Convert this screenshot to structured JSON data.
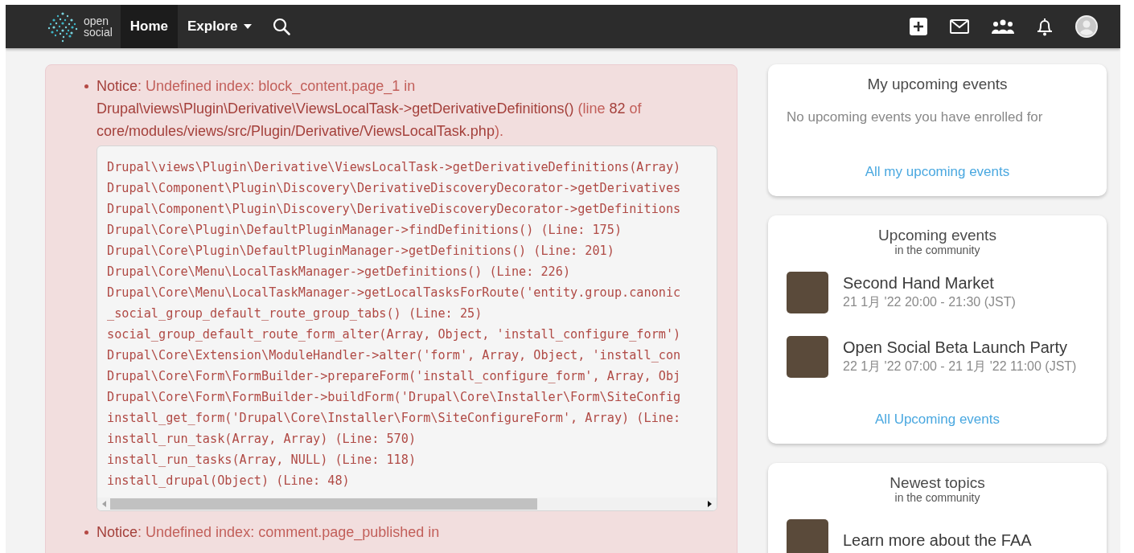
{
  "navbar": {
    "logo": {
      "line_1": "open",
      "line_2": "social"
    },
    "items": [
      {
        "label": "Home",
        "selected": true,
        "kind": "link"
      },
      {
        "label": "Explore",
        "selected": false,
        "kind": "dropdown"
      }
    ],
    "actions": [
      {
        "kind": "create"
      },
      {
        "kind": "messages"
      },
      {
        "kind": "groups"
      },
      {
        "kind": "notifications"
      },
      {
        "kind": "account"
      }
    ]
  },
  "messages": [
    {
      "text": "**Notice**: Undefined index: block_content.page_1 in **Drupal\\views\\Plugin\\Derivative\\ViewsLocalTask->getDerivativeDefinitions()** (line **82** of **core/modules/views/src/Plugin/Derivative/ViewsLocalTask.php**).",
      "trace": [
        "Drupal\\views\\Plugin\\Derivative\\ViewsLocalTask->getDerivativeDefinitions(Array)",
        "Drupal\\Component\\Plugin\\Discovery\\DerivativeDiscoveryDecorator->getDerivatives",
        "Drupal\\Component\\Plugin\\Discovery\\DerivativeDiscoveryDecorator->getDefinitions",
        "Drupal\\Core\\Plugin\\DefaultPluginManager->findDefinitions() (Line: 175)",
        "Drupal\\Core\\Plugin\\DefaultPluginManager->getDefinitions() (Line: 201)",
        "Drupal\\Core\\Menu\\LocalTaskManager->getDefinitions() (Line: 226)",
        "Drupal\\Core\\Menu\\LocalTaskManager->getLocalTasksForRoute('entity.group.canonic",
        "_social_group_default_route_group_tabs() (Line: 25)",
        "social_group_default_route_form_alter(Array, Object, 'install_configure_form')",
        "Drupal\\Core\\Extension\\ModuleHandler->alter('form', Array, Object, 'install_con",
        "Drupal\\Core\\Form\\FormBuilder->prepareForm('install_configure_form', Array, Obj",
        "Drupal\\Core\\Form\\FormBuilder->buildForm('Drupal\\Core\\Installer\\Form\\SiteConfig",
        "install_get_form('Drupal\\Core\\Installer\\Form\\SiteConfigureForm', Array) (Line:",
        "install_run_task(Array, Array) (Line: 570)",
        "install_run_tasks(Array, NULL) (Line: 118)",
        "install_drupal(Object) (Line: 48)"
      ]
    },
    {
      "text": "**Notice**: Undefined index: comment.page_published in"
    }
  ],
  "sidebar": [
    {
      "title": "My upcoming events",
      "empty_text": "No upcoming events you have enrolled for",
      "link": "All my upcoming events"
    },
    {
      "title": "Upcoming events",
      "subtitle": "in the community",
      "items": [
        {
          "title": "Second Hand Market",
          "date": "21 1月 '22 20:00 - 21:30 (JST)"
        },
        {
          "title": "Open Social Beta Launch Party",
          "date": "22 1月 '22 07:00 - 21 1月 '22 11:00 (JST)"
        }
      ],
      "link": "All Upcoming events"
    },
    {
      "title": "Newest topics",
      "subtitle": "in the community",
      "items": [
        {
          "title": "Learn more about the FAA"
        }
      ]
    }
  ]
}
